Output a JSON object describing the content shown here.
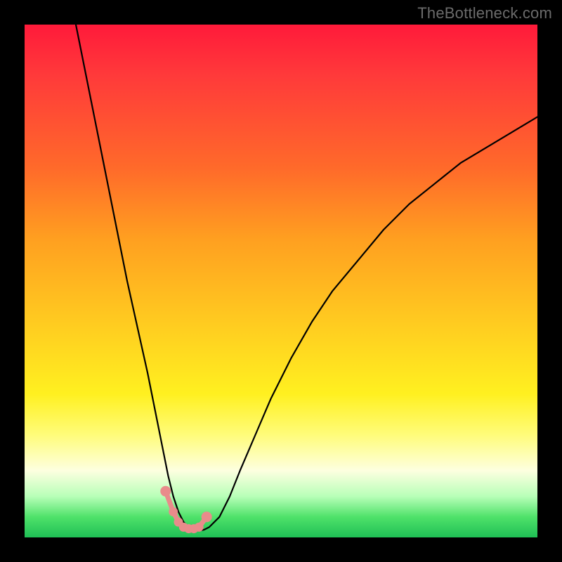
{
  "watermark": {
    "text": "TheBottleneck.com"
  },
  "chart_data": {
    "type": "line",
    "title": "",
    "xlabel": "",
    "ylabel": "",
    "xlim": [
      0,
      100
    ],
    "ylim": [
      0,
      100
    ],
    "grid": false,
    "background": "rainbow-gradient-red-to-green",
    "series": [
      {
        "name": "curve",
        "color": "#000000",
        "x": [
          10,
          12,
          14,
          16,
          18,
          20,
          22,
          24,
          25,
          26,
          27,
          28,
          29,
          30,
          31,
          32,
          33,
          34,
          35,
          36,
          38,
          40,
          42,
          45,
          48,
          52,
          56,
          60,
          65,
          70,
          75,
          80,
          85,
          90,
          95,
          100
        ],
        "y": [
          100,
          90,
          80,
          70,
          60,
          50,
          41,
          32,
          27,
          22,
          17,
          12,
          8,
          5,
          3,
          2,
          1.5,
          1.3,
          1.5,
          2,
          4,
          8,
          13,
          20,
          27,
          35,
          42,
          48,
          54,
          60,
          65,
          69,
          73,
          76,
          79,
          82
        ]
      }
    ],
    "markers": {
      "name": "highlight-points",
      "color": "#e98b8b",
      "x": [
        27.5,
        29,
        30,
        31,
        32,
        33,
        34,
        35.5
      ],
      "y": [
        9,
        5,
        3,
        2,
        1.7,
        1.7,
        2,
        4
      ]
    }
  }
}
